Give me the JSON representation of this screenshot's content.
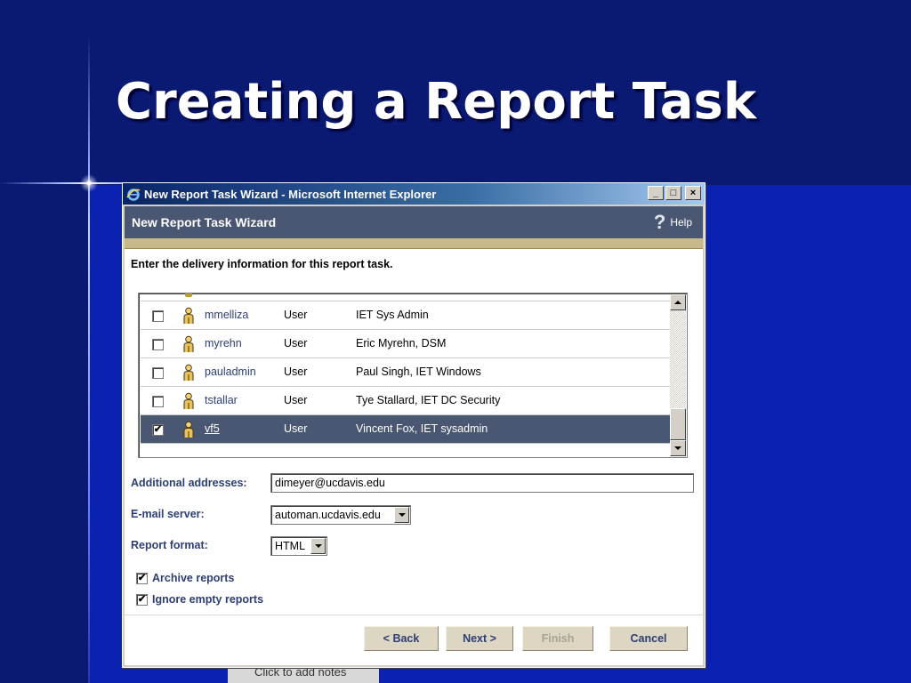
{
  "slide": {
    "title": "Creating a Report Task",
    "behind_text": "Click to add notes"
  },
  "window": {
    "title": "New Report Task Wizard - Microsoft Internet Explorer",
    "controls": {
      "minimize": "_",
      "maximize": "□",
      "close": "×"
    }
  },
  "wizard": {
    "title": "New Report Task Wizard",
    "help_label": "Help",
    "instruction": "Enter the delivery information for this report task."
  },
  "recipients": [
    {
      "id": "mmelliza",
      "type": "User",
      "description": "IET Sys Admin",
      "checked": false,
      "selected": false
    },
    {
      "id": "myrehn",
      "type": "User",
      "description": "Eric Myrehn, DSM",
      "checked": false,
      "selected": false
    },
    {
      "id": "pauladmin",
      "type": "User",
      "description": "Paul Singh, IET Windows",
      "checked": false,
      "selected": false
    },
    {
      "id": "tstallar",
      "type": "User",
      "description": "Tye Stallard, IET DC Security",
      "checked": false,
      "selected": false
    },
    {
      "id": "vf5",
      "type": "User",
      "description": "Vincent Fox, IET sysadmin",
      "checked": true,
      "selected": true
    }
  ],
  "form": {
    "additional_label": "Additional addresses:",
    "additional_value": "dimeyer@ucdavis.edu",
    "email_server_label": "E-mail server:",
    "email_server_value": "automan.ucdavis.edu",
    "report_format_label": "Report format:",
    "report_format_value": "HTML",
    "archive_label": "Archive reports",
    "archive_checked": true,
    "ignore_label": "Ignore empty reports",
    "ignore_checked": true
  },
  "buttons": {
    "back": "< Back",
    "next": "Next >",
    "finish": "Finish",
    "cancel": "Cancel"
  },
  "colors": {
    "selection": "#4a5772",
    "header": "#4a5772",
    "label": "#2d3e74",
    "slide_bg": "#0a1a73"
  }
}
